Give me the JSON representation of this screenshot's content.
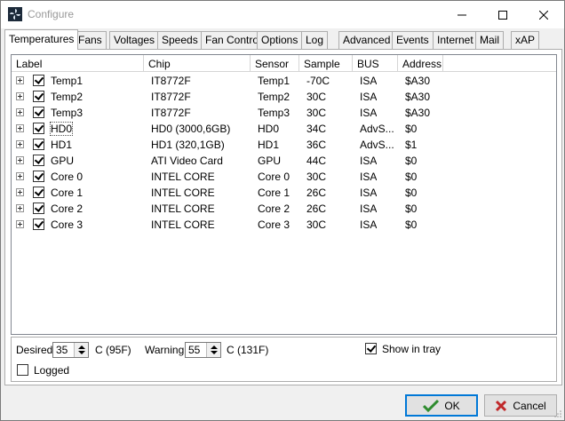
{
  "window": {
    "title": "Configure",
    "minimize_icon": "minimize-icon",
    "maximize_icon": "maximize-icon",
    "close_icon": "close-icon"
  },
  "tabs": [
    {
      "label": "Temperatures",
      "active": true
    },
    {
      "label": "Fans"
    },
    {
      "label": "Voltages"
    },
    {
      "label": "Speeds"
    },
    {
      "label": "Fan Control"
    },
    {
      "label": "Options"
    },
    {
      "label": "Log"
    },
    {
      "label": "Advanced"
    },
    {
      "label": "Events"
    },
    {
      "label": "Internet"
    },
    {
      "label": "Mail"
    },
    {
      "label": "xAP"
    }
  ],
  "table": {
    "columns": [
      "Label",
      "Chip",
      "Sensor",
      "Sample",
      "BUS",
      "Address"
    ],
    "rows": [
      {
        "checked": true,
        "label": "Temp1",
        "chip": "IT8772F",
        "sensor": "Temp1",
        "sample": "-70C",
        "bus": "ISA",
        "address": "$A30"
      },
      {
        "checked": true,
        "label": "Temp2",
        "chip": "IT8772F",
        "sensor": "Temp2",
        "sample": "30C",
        "bus": "ISA",
        "address": "$A30"
      },
      {
        "checked": true,
        "label": "Temp3",
        "chip": "IT8772F",
        "sensor": "Temp3",
        "sample": "30C",
        "bus": "ISA",
        "address": "$A30"
      },
      {
        "checked": true,
        "label": "HD0",
        "chip": "HD0 (3000,6GB)",
        "sensor": "HD0",
        "sample": "34C",
        "bus": "AdvS...",
        "address": "$0",
        "focused": true
      },
      {
        "checked": true,
        "label": "HD1",
        "chip": "HD1 (320,1GB)",
        "sensor": "HD1",
        "sample": "36C",
        "bus": "AdvS...",
        "address": "$1"
      },
      {
        "checked": true,
        "label": "GPU",
        "chip": "ATI Video Card",
        "sensor": "GPU",
        "sample": "44C",
        "bus": "ISA",
        "address": "$0"
      },
      {
        "checked": true,
        "label": "Core 0",
        "chip": "INTEL CORE",
        "sensor": "Core 0",
        "sample": "30C",
        "bus": "ISA",
        "address": "$0"
      },
      {
        "checked": true,
        "label": "Core 1",
        "chip": "INTEL CORE",
        "sensor": "Core 1",
        "sample": "26C",
        "bus": "ISA",
        "address": "$0"
      },
      {
        "checked": true,
        "label": "Core 2",
        "chip": "INTEL CORE",
        "sensor": "Core 2",
        "sample": "26C",
        "bus": "ISA",
        "address": "$0"
      },
      {
        "checked": true,
        "label": "Core 3",
        "chip": "INTEL CORE",
        "sensor": "Core 3",
        "sample": "30C",
        "bus": "ISA",
        "address": "$0"
      }
    ]
  },
  "settings": {
    "desired_label": "Desired",
    "desired_value": "35",
    "desired_unit": "C (95F)",
    "warning_label": "Warning",
    "warning_value": "55",
    "warning_unit": "C (131F)",
    "show_in_tray_label": "Show in tray",
    "show_in_tray_checked": true,
    "logged_label": "Logged",
    "logged_checked": false
  },
  "buttons": {
    "ok_label": "OK",
    "cancel_label": "Cancel"
  },
  "colors": {
    "ok_check": "#2e8b2e",
    "cancel_x": "#c0282a",
    "accent": "#0078d7"
  }
}
